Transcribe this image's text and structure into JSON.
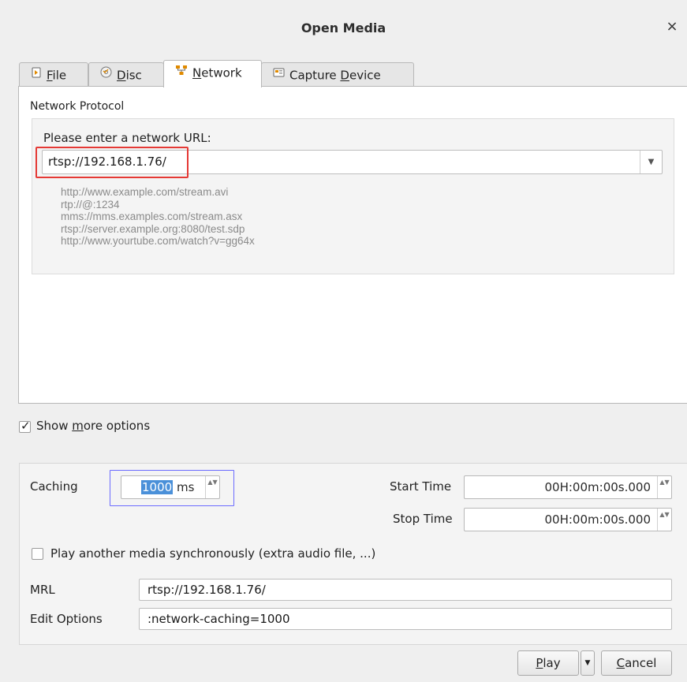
{
  "window": {
    "title": "Open Media",
    "close_glyph": "×"
  },
  "tabs": [
    {
      "label_mnemonic": "F",
      "label_rest": "ile",
      "icon": "file-icon"
    },
    {
      "label_mnemonic": "D",
      "label_rest": "isc",
      "icon": "disc-icon"
    },
    {
      "label_mnemonic": "N",
      "label_rest": "etwork",
      "icon": "network-icon"
    },
    {
      "label_pre": "Capture ",
      "label_mnemonic": "D",
      "label_rest": "evice",
      "icon": "capture-device-icon"
    }
  ],
  "active_tab": "Network",
  "network": {
    "section_label": "Network Protocol",
    "url_prompt": "Please enter a network URL:",
    "url_value": "rtsp://192.168.1.76/",
    "dropdown_glyph": "▼",
    "examples": [
      "http://www.example.com/stream.avi",
      "rtp://@:1234",
      "mms://mms.examples.com/stream.asx",
      "rtsp://server.example.org:8080/test.sdp",
      "http://www.yourtube.com/watch?v=gg64x"
    ]
  },
  "show_more": {
    "checked": true,
    "check_glyph": "✓",
    "label_pre": "Show ",
    "label_mnemonic": "m",
    "label_rest": "ore options"
  },
  "options": {
    "caching_label": "Caching",
    "caching_value": "1000",
    "caching_unit": " ms",
    "start_time_label": "Start Time",
    "start_time_value": "00H:00m:00s.000",
    "stop_time_label": "Stop Time",
    "stop_time_value": "00H:00m:00s.000",
    "sync_label": "Play another media synchronously (extra audio file, ...)",
    "sync_checked": false,
    "mrl_label": "MRL",
    "mrl_value": "rtsp://192.168.1.76/",
    "edit_options_label": "Edit Options",
    "edit_options_value": ":network-caching=1000",
    "spin_glyph": "▲▼"
  },
  "buttons": {
    "play_mnemonic": "P",
    "play_rest": "lay",
    "play_menu_glyph": "▼",
    "cancel_mnemonic": "C",
    "cancel_rest": "ancel"
  }
}
